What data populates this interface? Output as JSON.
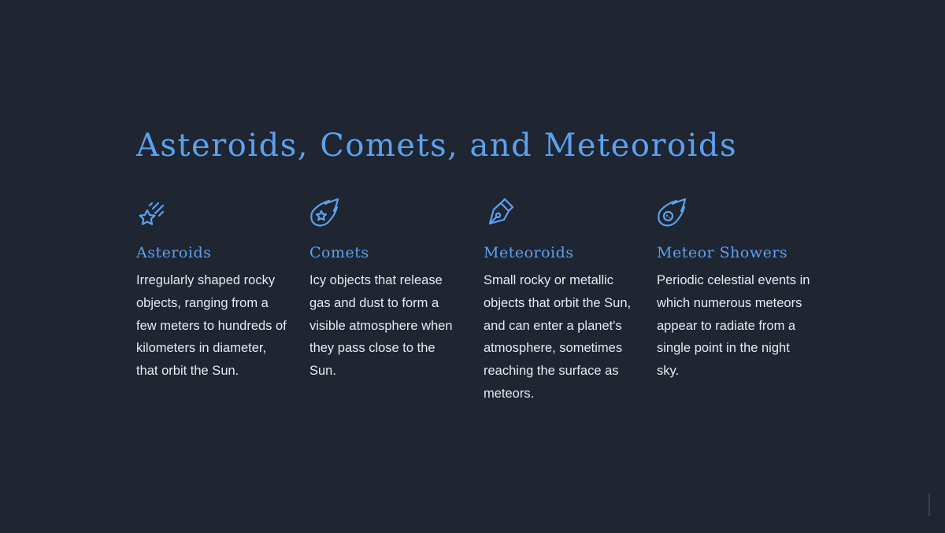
{
  "slide": {
    "title": "Asteroids, Comets, and Meteoroids",
    "accent_color": "#5aa2f0",
    "background_color": "#202532",
    "cards": [
      {
        "icon": "shooting-star-icon",
        "title": "Asteroids",
        "text": "Irregularly shaped rocky objects, ranging from a few meters to hundreds of kilometers in diameter, that orbit the Sun."
      },
      {
        "icon": "comet-star-icon",
        "title": "Comets",
        "text": "Icy objects that release gas and dust to form a visible atmosphere when they pass close to the Sun."
      },
      {
        "icon": "pen-nib-icon",
        "title": "Meteoroids",
        "text": "Small rocky or metallic objects that orbit the Sun, and can enter a planet's atmosphere, sometimes reaching the surface as meteors."
      },
      {
        "icon": "meteor-icon",
        "title": "Meteor Showers",
        "text": "Periodic celestial events in which numerous meteors appear to radiate from a single point in the night sky."
      }
    ]
  }
}
